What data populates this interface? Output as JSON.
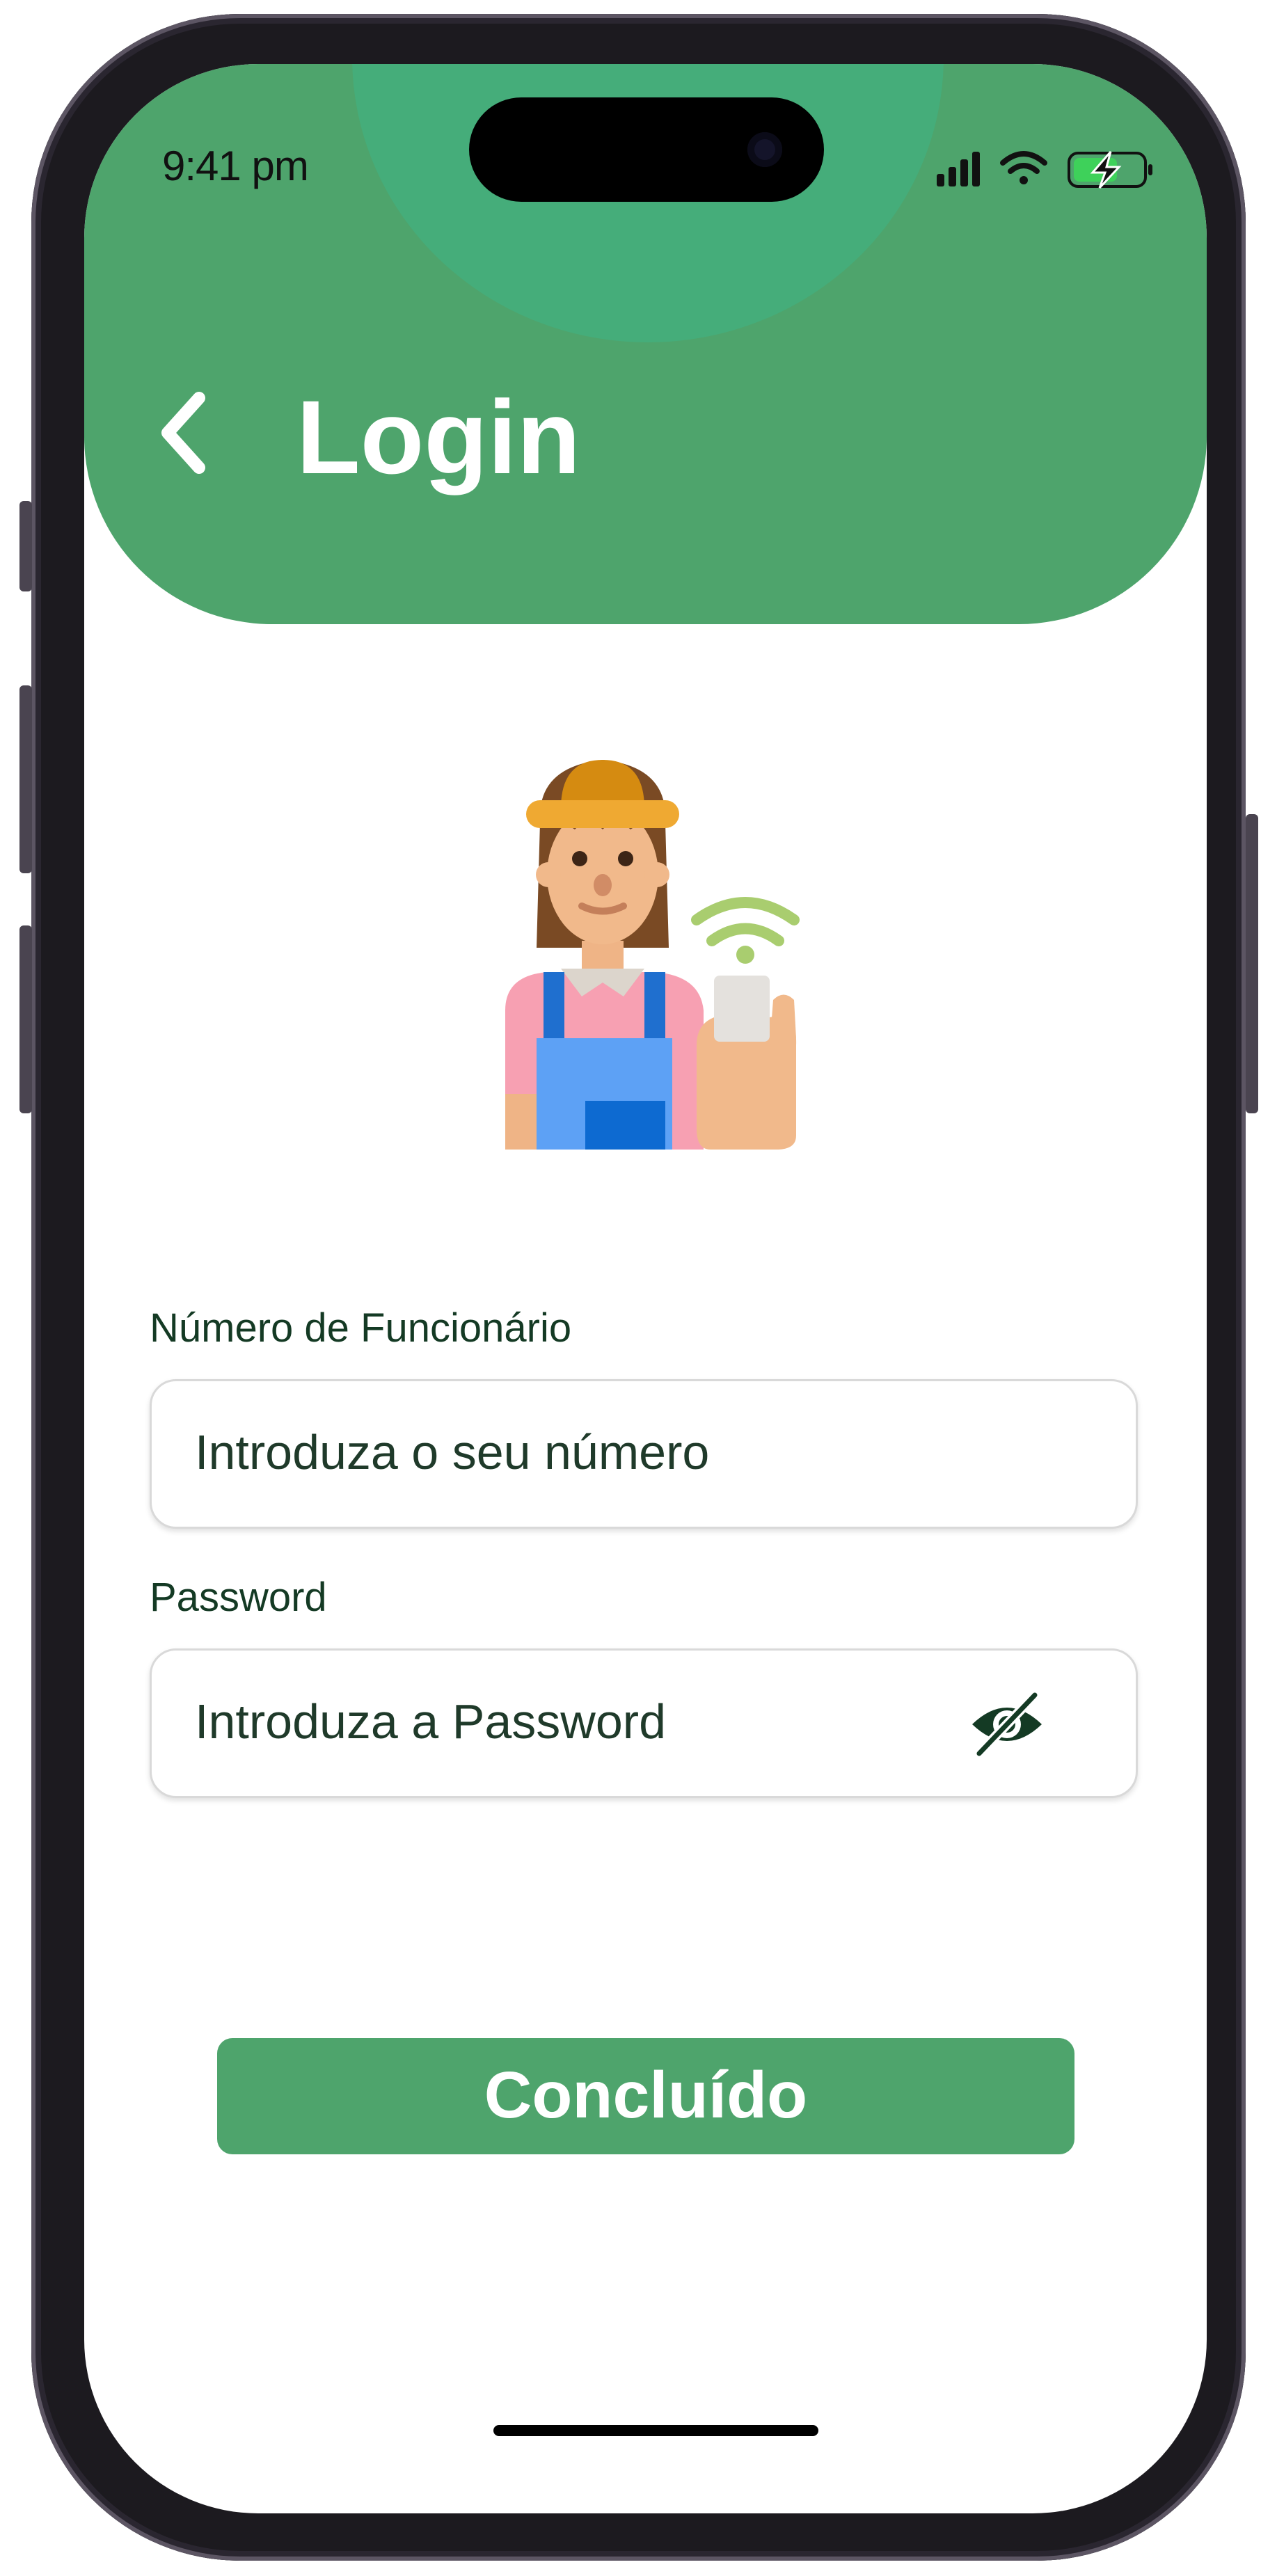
{
  "status_bar": {
    "time": "9:41 pm",
    "icons": [
      "signal-icon",
      "wifi-icon",
      "battery-charging-icon"
    ]
  },
  "header": {
    "title": "Login",
    "back_icon": "chevron-left-icon",
    "background_color": "#4ea46c"
  },
  "avatar": {
    "icon": "farmer-with-phone-illustration"
  },
  "form": {
    "employee_number": {
      "label": "Número de Funcionário",
      "placeholder": "Introduza o seu número",
      "value": ""
    },
    "password": {
      "label": "Password",
      "placeholder": "Introduza a Password",
      "value": "",
      "visibility_icon": "eye-off-icon"
    }
  },
  "submit": {
    "label": "Concluído",
    "color": "#4ea46c"
  }
}
